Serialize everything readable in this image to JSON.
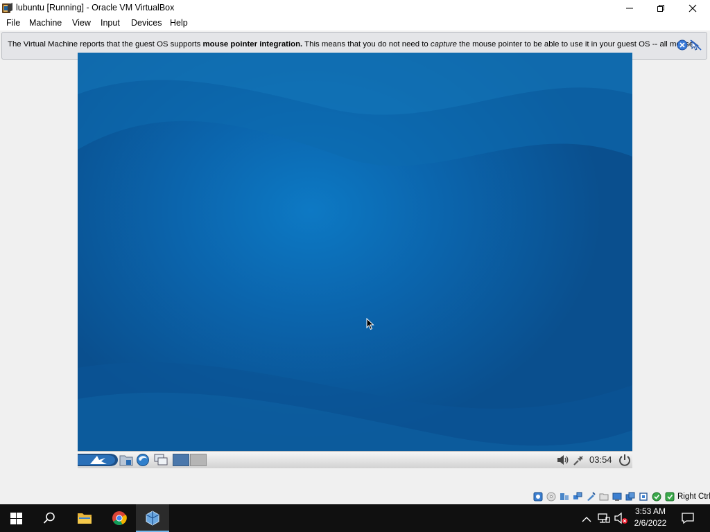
{
  "window": {
    "title": "lubuntu [Running] - Oracle VM VirtualBox",
    "app_icon": "virtualbox-icon",
    "controls": [
      "minimize-icon",
      "restore-icon",
      "close-icon"
    ]
  },
  "menubar": {
    "items": [
      {
        "label": "File"
      },
      {
        "label": "Machine"
      },
      {
        "label": "View"
      },
      {
        "label": "Input"
      },
      {
        "label": "Devices"
      },
      {
        "label": "Help"
      }
    ]
  },
  "notification": {
    "text_1": "The Virtual Machine reports that the guest OS supports ",
    "bold": "mouse pointer integration.",
    "text_2": " This means that you do not need to ",
    "italic": "capture",
    "text_3": " the mouse pointer to be able to use it in your guest OS -- all mouse",
    "icons": [
      "info-close-icon",
      "do-not-show-again-icon"
    ]
  },
  "guest": {
    "panel_icons": [
      "lxde-menu-icon",
      "file-manager-icon",
      "web-browser-icon",
      "show-desktop-icon"
    ],
    "desktops": [
      "desktop-1",
      "desktop-2"
    ],
    "tray_icons": [
      "volume-icon",
      "network-icon"
    ],
    "clock": "03:54",
    "power_icon": "power-icon",
    "wallpaper_colors": [
      "#0d79c4",
      "#0a4f8e"
    ]
  },
  "statusbar": {
    "icons": [
      "hard-disk-icon",
      "optical-drive-icon",
      "audio-icon",
      "network-adapter-icon",
      "usb-icon",
      "shared-folders-icon",
      "display-icon",
      "video-capture-icon",
      "cpu-icon",
      "mouse-integration-icon",
      "keyboard-icon"
    ],
    "host_key": "Right Ctrl"
  },
  "taskbar": {
    "items": [
      "windows-start-icon",
      "search-icon",
      "file-explorer-icon",
      "chrome-icon",
      "virtualbox-taskbar-icon"
    ],
    "tray_icons": [
      "chevron-up-icon",
      "network-icon",
      "volume-muted-icon"
    ],
    "time": "3:53 AM",
    "date": "2/6/2022",
    "notification_icon": "action-center-icon"
  }
}
